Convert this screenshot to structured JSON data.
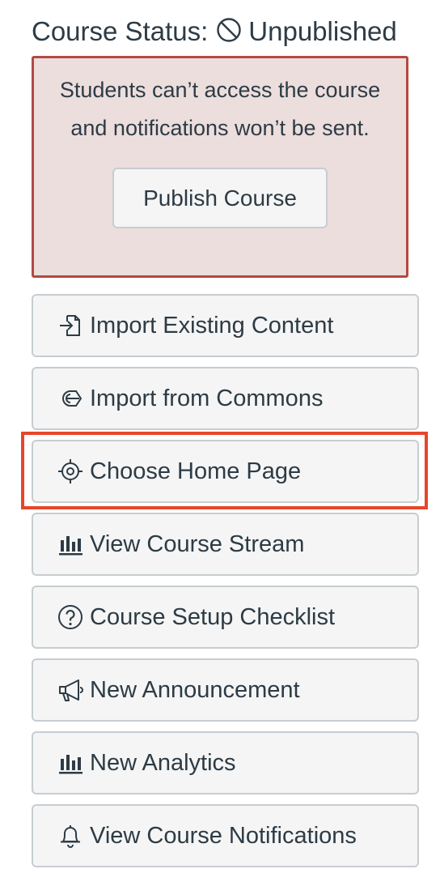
{
  "course_status": {
    "label": "Course Status:",
    "state": "Unpublished",
    "icon": "unpublished-icon"
  },
  "alert": {
    "line1": "Students can’t access the course",
    "line2": "and notifications won’t be sent.",
    "publish_label": "Publish Course",
    "border_color": "#b24a43",
    "background_color": "#ecdedd"
  },
  "actions": [
    {
      "label": "Import Existing Content",
      "icon": "import-icon"
    },
    {
      "label": "Import from Commons",
      "icon": "commons-icon"
    },
    {
      "label": "Choose Home Page",
      "icon": "target-icon"
    },
    {
      "label": "View Course Stream",
      "icon": "bar-chart-icon"
    },
    {
      "label": "Course Setup Checklist",
      "icon": "question-circle-icon"
    },
    {
      "label": "New Announcement",
      "icon": "megaphone-icon"
    },
    {
      "label": "New Analytics",
      "icon": "bar-chart-icon"
    },
    {
      "label": "View Course Notifications",
      "icon": "bell-icon"
    }
  ],
  "highlight": {
    "target": "Choose Home Page",
    "color": "#e8452c"
  }
}
